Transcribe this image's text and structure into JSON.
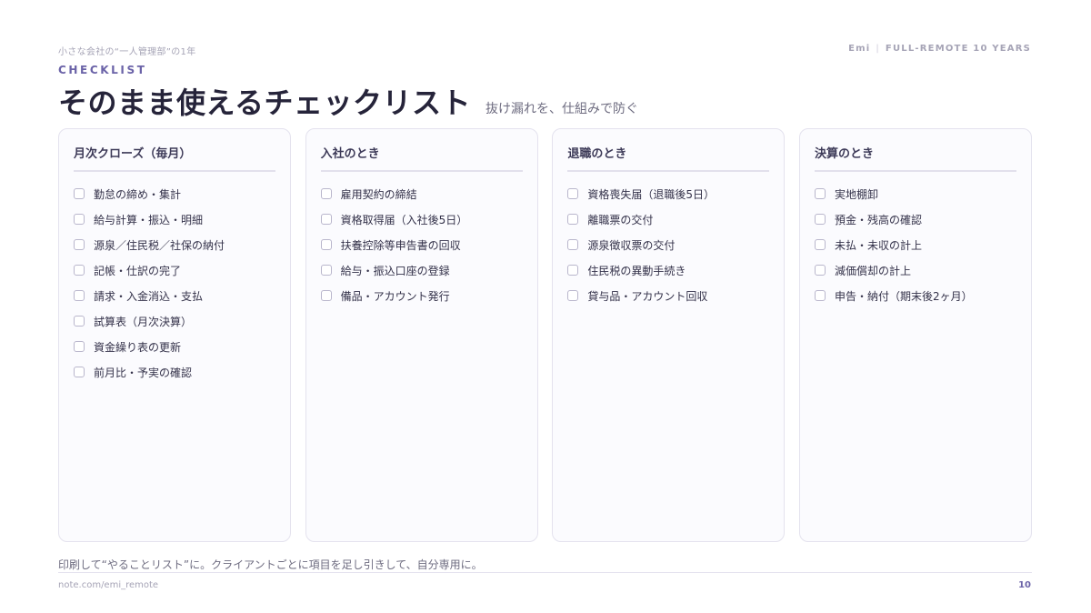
{
  "header": {
    "series": "小さな会社の“一人管理部”の1年",
    "author": "Emi",
    "tagline": "FULL-REMOTE 10 YEARS",
    "eyebrow": "CHECKLIST",
    "title": "そのまま使えるチェックリスト",
    "subtitle": "抜け漏れを、仕組みで防ぐ"
  },
  "columns": [
    {
      "title": "月次クローズ（毎月）",
      "items": [
        "勤怠の締め・集計",
        "給与計算・振込・明細",
        "源泉／住民税／社保の納付",
        "記帳・仕訳の完了",
        "請求・入金消込・支払",
        "試算表（月次決算）",
        "資金繰り表の更新",
        "前月比・予実の確認"
      ]
    },
    {
      "title": "入社のとき",
      "items": [
        "雇用契約の締結",
        "資格取得届（入社後5日）",
        "扶養控除等申告書の回収",
        "給与・振込口座の登録",
        "備品・アカウント発行"
      ]
    },
    {
      "title": "退職のとき",
      "items": [
        "資格喪失届（退職後5日）",
        "離職票の交付",
        "源泉徴収票の交付",
        "住民税の異動手続き",
        "貸与品・アカウント回収"
      ]
    },
    {
      "title": "決算のとき",
      "items": [
        "実地棚卸",
        "預金・残高の確認",
        "未払・未収の計上",
        "減価償却の計上",
        "申告・納付（期末後2ヶ月）"
      ]
    }
  ],
  "footer": {
    "caption": "印刷して“やることリスト”に。クライアントごとに項目を足し引きして、自分専用に。",
    "url": "note.com/emi_remote",
    "page": "10"
  }
}
